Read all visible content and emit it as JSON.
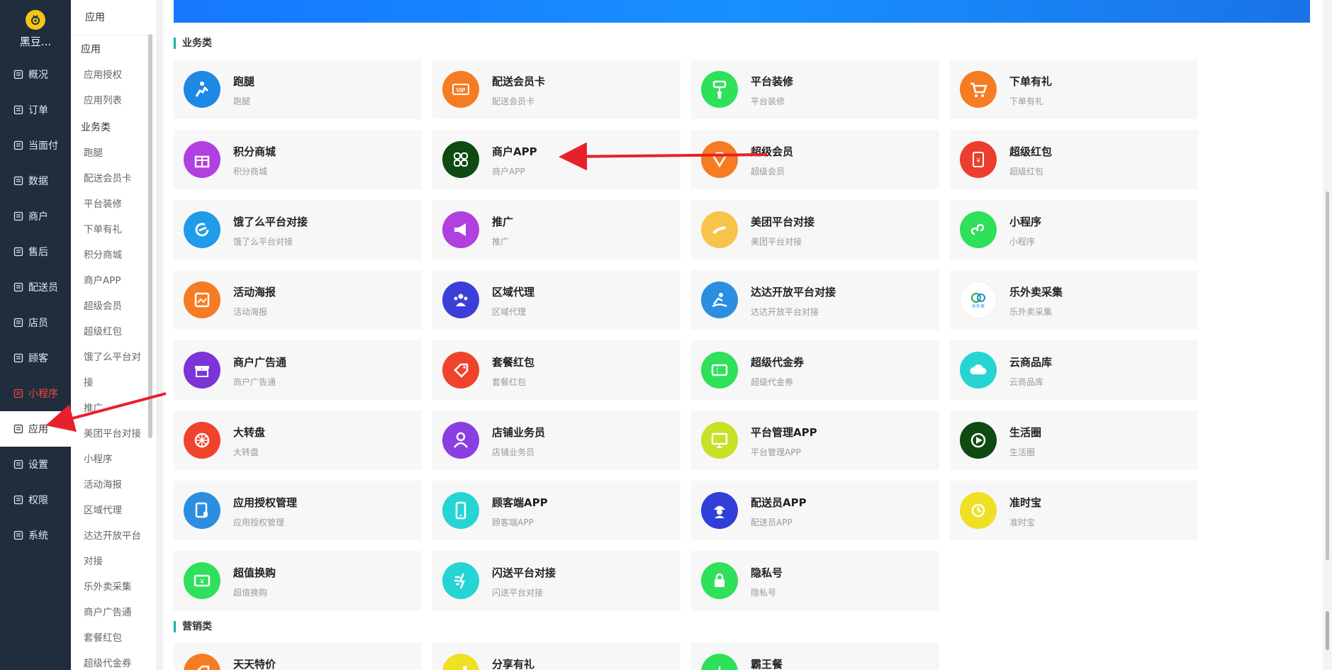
{
  "brand": {
    "name": "黑豆..."
  },
  "nav": [
    {
      "label": "概况",
      "icon": "overview-icon"
    },
    {
      "label": "订单",
      "icon": "order-icon"
    },
    {
      "label": "当面付",
      "icon": "pay-icon"
    },
    {
      "label": "数据",
      "icon": "data-icon"
    },
    {
      "label": "商户",
      "icon": "shop-icon"
    },
    {
      "label": "售后",
      "icon": "after-sale-icon"
    },
    {
      "label": "配送员",
      "icon": "courier-icon"
    },
    {
      "label": "店员",
      "icon": "clerk-icon"
    },
    {
      "label": "顾客",
      "icon": "customer-icon"
    },
    {
      "label": "小程序",
      "icon": "miniapp-icon"
    },
    {
      "label": "应用",
      "icon": "apps-icon"
    },
    {
      "label": "设置",
      "icon": "settings-icon"
    },
    {
      "label": "权限",
      "icon": "lock-icon"
    },
    {
      "label": "系统",
      "icon": "system-icon"
    }
  ],
  "sub": {
    "head": "应用",
    "group1": "应用",
    "group1_items": [
      "应用授权",
      "应用列表"
    ],
    "group2": "业务类",
    "group2_items": [
      "跑腿",
      "配送会员卡",
      "平台装修",
      "下单有礼",
      "积分商城",
      "商户APP",
      "超级会员",
      "超级红包",
      "饿了么平台对",
      "接",
      "推广",
      "美团平台对接",
      "小程序",
      "活动海报",
      "区域代理",
      "达达开放平台",
      "对接",
      "乐外卖采集",
      "商户广告通",
      "套餐红包",
      "超级代金券"
    ]
  },
  "sections": {
    "business": "业务类",
    "marketing": "营销类"
  },
  "cards": [
    {
      "title": "跑腿",
      "sub": "跑腿",
      "color": "#1e88e5",
      "icon": "runner-icon"
    },
    {
      "title": "配送会员卡",
      "sub": "配送会员卡",
      "color": "#f57c22",
      "icon": "vip-card-icon"
    },
    {
      "title": "平台装修",
      "sub": "平台装修",
      "color": "#2ee05a",
      "icon": "paint-roller-icon"
    },
    {
      "title": "下单有礼",
      "sub": "下单有礼",
      "color": "#f57c22",
      "icon": "cart-icon"
    },
    {
      "title": "积分商城",
      "sub": "积分商城",
      "color": "#b23fe0",
      "icon": "gift-icon"
    },
    {
      "title": "商户APP",
      "sub": "商户APP",
      "color": "#0e4a12",
      "icon": "grid-icon"
    },
    {
      "title": "超级会员",
      "sub": "超级会员",
      "color": "#f57c22",
      "icon": "diamond-icon"
    },
    {
      "title": "超级红包",
      "sub": "超级红包",
      "color": "#ec3d2e",
      "icon": "red-packet-icon"
    },
    {
      "title": "饿了么平台对接",
      "sub": "饿了么平台对接",
      "color": "#1e9be9",
      "icon": "eleme-icon"
    },
    {
      "title": "推广",
      "sub": "推广",
      "color": "#b23fe0",
      "icon": "megaphone-icon"
    },
    {
      "title": "美团平台对接",
      "sub": "美团平台对接",
      "color": "#f8c34a",
      "icon": "kangaroo-icon"
    },
    {
      "title": "小程序",
      "sub": "小程序",
      "color": "#2ee05a",
      "icon": "miniprogram-icon"
    },
    {
      "title": "活动海报",
      "sub": "活动海报",
      "color": "#f57c22",
      "icon": "poster-icon"
    },
    {
      "title": "区域代理",
      "sub": "区域代理",
      "color": "#3b3fd8",
      "icon": "people-icon"
    },
    {
      "title": "达达开放平台对接",
      "sub": "达达开放平台对接",
      "color": "#2b8ee0",
      "icon": "dada-icon"
    },
    {
      "title": "乐外卖采集",
      "sub": "乐外卖采集",
      "color": "#ffffff",
      "icon": "lewaimai-icon"
    },
    {
      "title": "商户广告通",
      "sub": "商户广告通",
      "color": "#7a34d8",
      "icon": "storefront-icon"
    },
    {
      "title": "套餐红包",
      "sub": "套餐红包",
      "color": "#f0432c",
      "icon": "tag-icon"
    },
    {
      "title": "超级代金券",
      "sub": "超级代金券",
      "color": "#2ee05a",
      "icon": "coupon-icon"
    },
    {
      "title": "云商品库",
      "sub": "云商品库",
      "color": "#26d4d4",
      "icon": "cloud-icon"
    },
    {
      "title": "大转盘",
      "sub": "大转盘",
      "color": "#f0432c",
      "icon": "wheel-icon"
    },
    {
      "title": "店铺业务员",
      "sub": "店铺业务员",
      "color": "#8a3fe0",
      "icon": "person-icon"
    },
    {
      "title": "平台管理APP",
      "sub": "平台管理APP",
      "color": "#c8e026",
      "icon": "monitor-icon"
    },
    {
      "title": "生活圈",
      "sub": "生活圈",
      "color": "#0e4a12",
      "icon": "play-icon"
    },
    {
      "title": "应用授权管理",
      "sub": "应用授权管理",
      "color": "#2b8ee0",
      "icon": "shield-doc-icon"
    },
    {
      "title": "顾客端APP",
      "sub": "顾客端APP",
      "color": "#26d4d4",
      "icon": "phone-icon"
    },
    {
      "title": "配送员APP",
      "sub": "配送员APP",
      "color": "#2f3fd8",
      "icon": "courier-helmet-icon"
    },
    {
      "title": "准时宝",
      "sub": "准时宝",
      "color": "#f0e024",
      "icon": "clock-icon"
    },
    {
      "title": "超值换购",
      "sub": "超值换购",
      "color": "#2ee05a",
      "icon": "yen-ticket-icon"
    },
    {
      "title": "闪送平台对接",
      "sub": "闪送平台对接",
      "color": "#26d4d4",
      "icon": "flash-icon"
    },
    {
      "title": "隐私号",
      "sub": "隐私号",
      "color": "#2ee05a",
      "icon": "padlock-icon"
    }
  ],
  "marketing_cards": [
    {
      "title": "天天特价",
      "color": "#f57c22",
      "icon": "price-tag-icon"
    },
    {
      "title": "分享有礼",
      "color": "#f0e024",
      "icon": "share-icon"
    },
    {
      "title": "霸王餐",
      "color": "#2ee05a",
      "icon": "meal-icon"
    }
  ]
}
